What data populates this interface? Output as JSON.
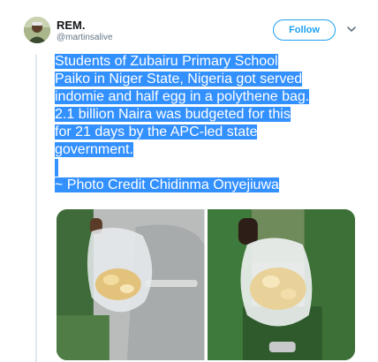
{
  "tweet": {
    "display_name": "REM.",
    "handle": "@martinsalive",
    "follow_label": "Follow",
    "text_lines": [
      "Students of Zubairu Primary School",
      "Paiko in Niger State, Nigeria got served",
      "indomie and half egg in a polythene bag.",
      "2.1 billion Naira was budgeted for this",
      "for 21 days by the APC-led state",
      "government."
    ],
    "credit": "~ Photo Credit Chidinma Onyejiuwa"
  },
  "icons": {
    "avatar": "user-avatar",
    "menu": "chevron-down-icon"
  },
  "colors": {
    "accent": "#1da1f2",
    "highlight": "#3390ff",
    "name": "#14171a",
    "muted": "#657786"
  }
}
